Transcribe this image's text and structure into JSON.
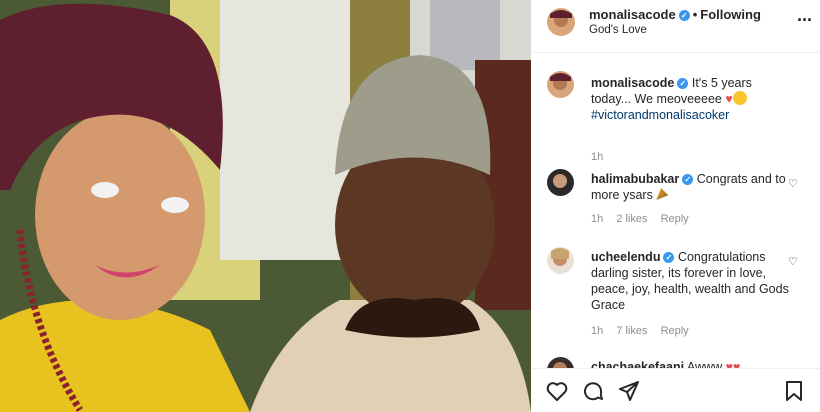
{
  "photo": {
    "alt_icon": "post-photo"
  },
  "header": {
    "username": "monalisacode",
    "verified_icon": "verified-badge-icon",
    "separator": "•",
    "following_label": "Following",
    "location": "God's Love",
    "more_icon": "more-options-icon"
  },
  "caption": {
    "username": "monalisacode",
    "text": "It's 5 years today... We meoveeeee",
    "hashtag": "#victorandmonalisacoker",
    "time": "1h"
  },
  "comments": [
    {
      "username": "halimabubakar",
      "text": "Congrats and to more ysars",
      "time": "1h",
      "likes": "2 likes",
      "reply_label": "Reply"
    },
    {
      "username": "ucheelendu",
      "text": "Congratulations darling sister, its forever in love, peace, joy, health, wealth and Gods Grace",
      "time": "1h",
      "likes": "7 likes",
      "reply_label": "Reply"
    },
    {
      "username": "chachaekefaani",
      "text": "Awww"
    }
  ],
  "actions": {
    "like_icon": "heart-icon",
    "comment_icon": "comment-icon",
    "share_icon": "share-icon",
    "save_icon": "bookmark-icon"
  },
  "colors": {
    "accent": "#3897f0",
    "heart": "#ed4956",
    "hashtag": "#00376b",
    "muted": "#8e8e8e"
  }
}
